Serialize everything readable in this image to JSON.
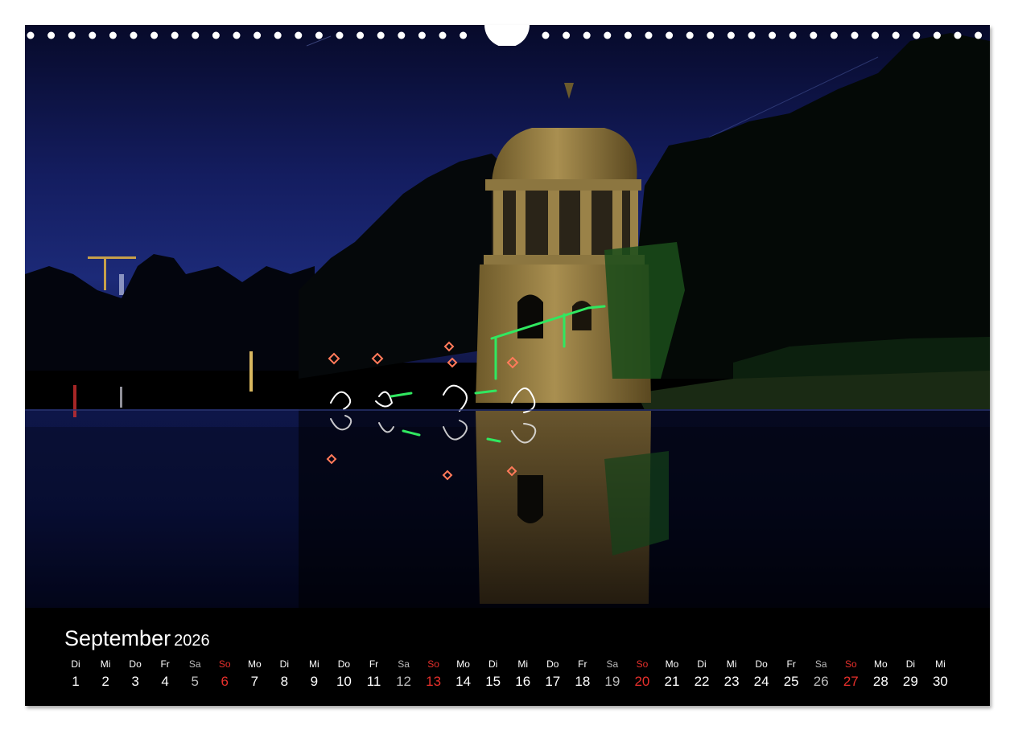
{
  "calendar": {
    "month": "September",
    "year": "2026",
    "days": [
      {
        "dn": "Di",
        "dd": "1"
      },
      {
        "dn": "Mi",
        "dd": "2"
      },
      {
        "dn": "Do",
        "dd": "3"
      },
      {
        "dn": "Fr",
        "dd": "4"
      },
      {
        "dn": "Sa",
        "dd": "5"
      },
      {
        "dn": "So",
        "dd": "6"
      },
      {
        "dn": "Mo",
        "dd": "7"
      },
      {
        "dn": "Di",
        "dd": "8"
      },
      {
        "dn": "Mi",
        "dd": "9"
      },
      {
        "dn": "Do",
        "dd": "10"
      },
      {
        "dn": "Fr",
        "dd": "11"
      },
      {
        "dn": "Sa",
        "dd": "12"
      },
      {
        "dn": "So",
        "dd": "13"
      },
      {
        "dn": "Mo",
        "dd": "14"
      },
      {
        "dn": "Di",
        "dd": "15"
      },
      {
        "dn": "Mi",
        "dd": "16"
      },
      {
        "dn": "Do",
        "dd": "17"
      },
      {
        "dn": "Fr",
        "dd": "18"
      },
      {
        "dn": "Sa",
        "dd": "19"
      },
      {
        "dn": "So",
        "dd": "20"
      },
      {
        "dn": "Mo",
        "dd": "21"
      },
      {
        "dn": "Di",
        "dd": "22"
      },
      {
        "dn": "Mi",
        "dd": "23"
      },
      {
        "dn": "Do",
        "dd": "24"
      },
      {
        "dn": "Fr",
        "dd": "25"
      },
      {
        "dn": "Sa",
        "dd": "26"
      },
      {
        "dn": "So",
        "dd": "27"
      },
      {
        "dn": "Mo",
        "dd": "28"
      },
      {
        "dn": "Di",
        "dd": "29"
      },
      {
        "dn": "Mi",
        "dd": "30"
      }
    ]
  },
  "colors": {
    "sunday": "#e8302c",
    "saturday": "#bbbbbb",
    "weekday": "#ffffff",
    "background": "#000000"
  }
}
